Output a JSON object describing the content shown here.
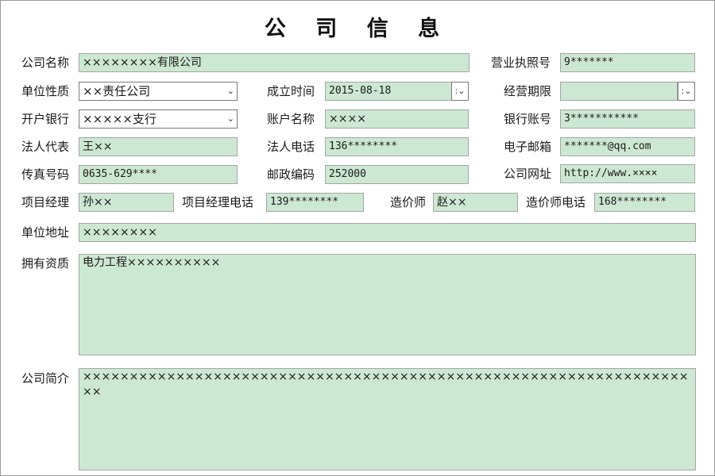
{
  "title": "公 司 信 息",
  "labels": {
    "company_name": "公司名称",
    "license_no": "营业执照号",
    "unit_nature": "单位性质",
    "established": "成立时间",
    "business_term": "经营期限",
    "bank": "开户银行",
    "account_name": "账户名称",
    "bank_account": "银行账号",
    "legal_rep": "法人代表",
    "legal_phone": "法人电话",
    "email": "电子邮箱",
    "fax": "传真号码",
    "postcode": "邮政编码",
    "website": "公司网址",
    "pm": "项目经理",
    "pm_phone": "项目经理电话",
    "cost_engineer": "造价师",
    "cost_engineer_phone": "造价师电话",
    "address": "单位地址",
    "qualification": "拥有资质",
    "intro": "公司简介"
  },
  "values": {
    "company_name": "××××××××有限公司",
    "license_no": "9*******",
    "unit_nature": "××责任公司",
    "established": "2015-08-18",
    "business_term": "",
    "bank": "×××××支行",
    "account_name": "××××",
    "bank_account": "3***********",
    "legal_rep": "王××",
    "legal_phone": "136********",
    "email": "*******@qq.com",
    "fax": "0635-629****",
    "postcode": "252000",
    "website": "http://www.××××",
    "pm": "孙××",
    "pm_phone": "139********",
    "cost_engineer": "赵××",
    "cost_engineer_phone": "168********",
    "address": "××××××××",
    "qualification": "电力工程××××××××××",
    "intro": "×××××××××××××××××××××××××××××××××××××××××××××××××××××××××××××××××××"
  },
  "icons": {
    "dropdown": "chevron-down-icon",
    "date_spin": "date-spinner-icon"
  },
  "colors": {
    "field_bg": "#cde8d2",
    "field_border": "#a5a5a5"
  }
}
